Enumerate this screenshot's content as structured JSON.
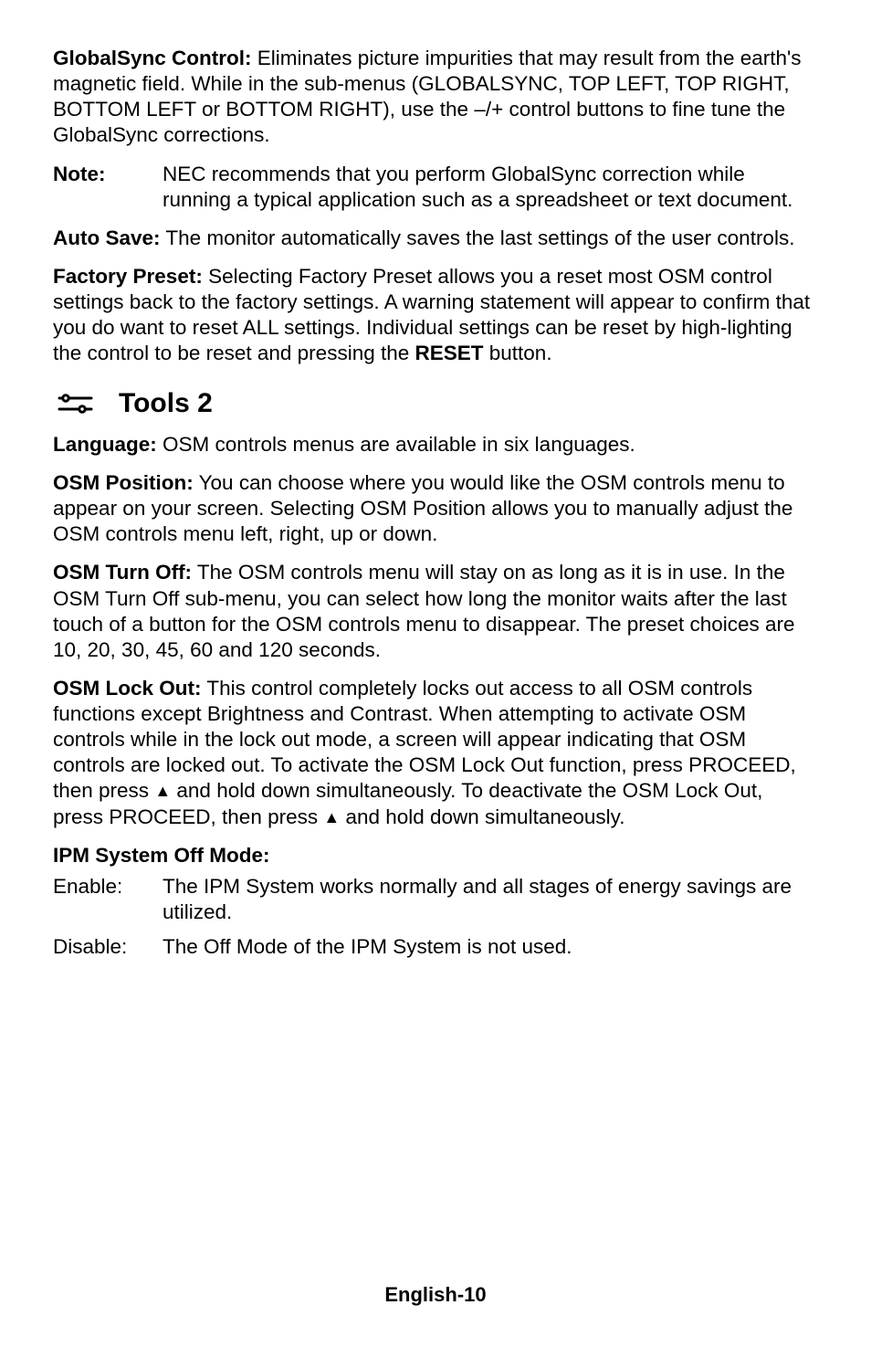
{
  "globalsync": {
    "label": "GlobalSync Control:",
    "text": " Eliminates picture impurities that may result from the earth's magnetic field. While in the sub-menus (GLOBALSYNC, TOP LEFT, TOP RIGHT, BOTTOM LEFT or BOTTOM RIGHT), use the –/+ control buttons to fine tune the GlobalSync corrections."
  },
  "note": {
    "label": "Note:",
    "text": "NEC recommends that you perform GlobalSync correction while running a typical application such as a spreadsheet or text document."
  },
  "autosave": {
    "label": "Auto Save:",
    "text": " The monitor automatically saves the last settings of the user controls."
  },
  "factory": {
    "label": "Factory Preset:",
    "text_pre": " Selecting Factory Preset allows you a reset most OSM control settings back to the factory settings. A warning statement will appear to confirm that you do want to reset ALL settings. Individual settings can be reset by high-lighting the control to be reset and pressing the ",
    "reset": "RESET",
    "text_post": " button."
  },
  "tools2": {
    "title": "Tools 2"
  },
  "language": {
    "label": "Language:",
    "text": " OSM controls menus are available in six languages."
  },
  "position": {
    "label": "OSM Position:",
    "text": " You can choose where you would like the OSM controls menu to appear on your screen. Selecting OSM Position allows you to manually adjust the OSM controls menu left, right, up or down."
  },
  "turnoff": {
    "label": "OSM Turn Off:",
    "text": " The OSM controls menu will stay on as long as it is in use. In the OSM Turn Off sub-menu, you can select how long the monitor waits after the last touch of a button for the OSM controls menu to disappear. The preset choices are 10, 20, 30, 45, 60 and 120 seconds."
  },
  "lockout": {
    "label": "OSM Lock Out:",
    "text_a": " This control completely locks out access to all OSM controls functions except Brightness and Contrast. When attempting to activate OSM controls while in the lock out mode, a screen will appear indicating that OSM controls are locked out. To activate the OSM Lock Out function, press PROCEED, then press ",
    "tri1": "▲",
    "text_b": " and hold down simultaneously. To deactivate the OSM Lock Out, press PROCEED, then press ",
    "tri2": "▲",
    "text_c": " and hold down simultaneously."
  },
  "ipm": {
    "heading": "IPM System Off Mode:",
    "enable_label": "Enable:",
    "enable_text": "The IPM System works normally and all stages of energy savings are utilized.",
    "disable_label": "Disable:",
    "disable_text": "The Off Mode of the IPM System is not used."
  },
  "footer": "English-10"
}
